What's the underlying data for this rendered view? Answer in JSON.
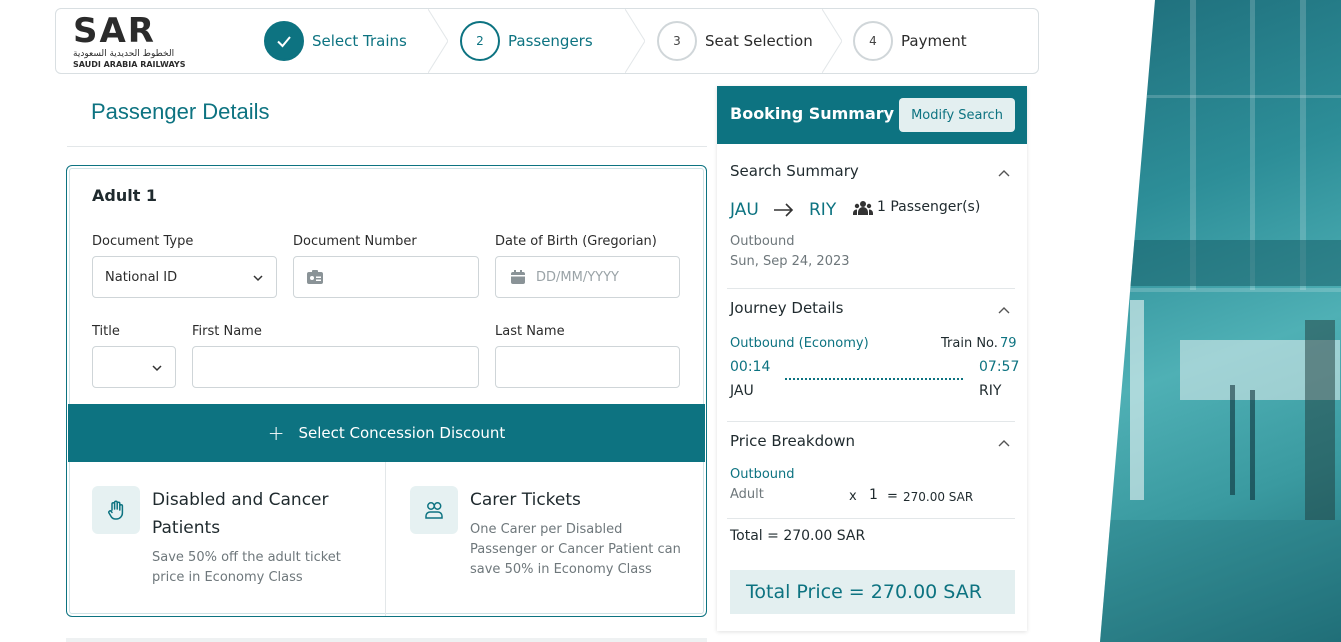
{
  "header": {
    "logo": {
      "text": "SAR",
      "arabic": "الخطوط الحديدية السعودية",
      "english": "SAUDI ARABIA RAILWAYS"
    },
    "steps": [
      {
        "number": "✓",
        "label": "Select Trains",
        "state": "done"
      },
      {
        "number": "2",
        "label": "Passengers",
        "state": "active"
      },
      {
        "number": "3",
        "label": "Seat Selection",
        "state": "pending"
      },
      {
        "number": "4",
        "label": "Payment",
        "state": "pending"
      }
    ]
  },
  "passenger": {
    "title": "Passenger Details",
    "adult_label": "Adult 1",
    "fields": {
      "document_type": {
        "label": "Document Type",
        "value": "National ID"
      },
      "document_number": {
        "label": "Document Number",
        "value": ""
      },
      "dob": {
        "label": "Date of Birth (Gregorian)",
        "placeholder": "DD/MM/YYYY"
      },
      "title": {
        "label": "Title",
        "value": ""
      },
      "first_name": {
        "label": "First Name",
        "value": ""
      },
      "last_name": {
        "label": "Last Name",
        "value": ""
      }
    },
    "concession_button": "Select Concession Discount",
    "tiles": [
      {
        "title": "Disabled and Cancer Patients",
        "desc_line1": "Save 50% off the adult ticket",
        "desc_line2": "price in Economy Class",
        "icon": "hand-icon"
      },
      {
        "title": "Carer Tickets",
        "desc_line1": "One Carer per Disabled",
        "desc_line2": "Passenger or Cancer Patient can",
        "desc_line3": "save 50% in Economy Class",
        "icon": "users-icon"
      }
    ]
  },
  "summary": {
    "title": "Booking Summary",
    "modify_label": "Modify Search",
    "search": {
      "title": "Search Summary",
      "from": "JAU",
      "to": "RIY",
      "passengers": "1 Passenger(s)",
      "direction": "Outbound",
      "date": "Sun, Sep 24, 2023"
    },
    "journey": {
      "title": "Journey Details",
      "leg": "Outbound (Economy)",
      "train_label": "Train No.",
      "train_no": "79",
      "depart_time": "00:14",
      "arrive_time": "07:57",
      "from": "JAU",
      "to": "RIY"
    },
    "price": {
      "title": "Price Breakdown",
      "leg": "Outbound",
      "pax_type": "Adult",
      "times": "x",
      "qty": "1",
      "equals": "=",
      "amount": "270.00 SAR",
      "total": "Total = 270.00 SAR",
      "grand_total": "Total Price = 270.00 SAR"
    }
  },
  "colors": {
    "accent": "#0d7381",
    "accent_light": "#e3eff0"
  }
}
